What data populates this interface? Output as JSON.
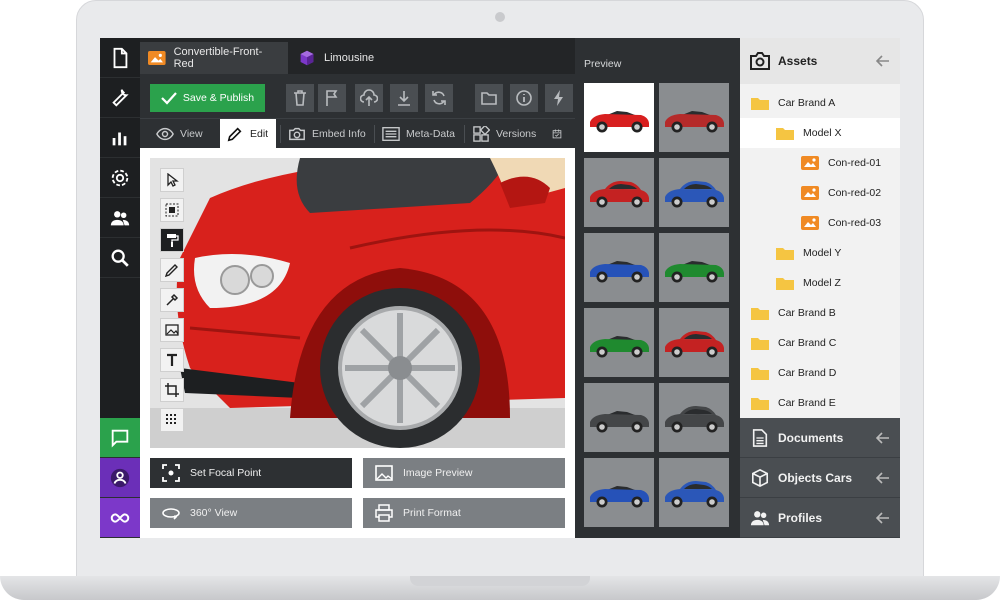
{
  "tabs": [
    {
      "label": "Convertible-Front-Red",
      "icon": "image-icon"
    },
    {
      "label": "Limousine",
      "icon": "cube-icon"
    }
  ],
  "toolbar": {
    "save_label": "Save & Publish",
    "buttons": [
      "trash-icon",
      "flag-icon",
      "upload-icon",
      "download-icon",
      "refresh-icon",
      "folder-icon",
      "info-icon",
      "lightning-icon"
    ]
  },
  "modes": [
    {
      "label": "View",
      "icon": "eye-icon"
    },
    {
      "label": "Edit",
      "icon": "pencil-icon"
    },
    {
      "label": "Embed Info",
      "icon": "camera-icon"
    },
    {
      "label": "Meta-Data",
      "icon": "list-icon"
    },
    {
      "label": "Versions",
      "icon": "versions-icon"
    }
  ],
  "edit_tools": [
    "cursor-icon",
    "select-icon",
    "paint-roller-icon",
    "pencil-icon",
    "eyedropper-icon",
    "image-icon",
    "text-icon",
    "crop-icon",
    "grid-icon"
  ],
  "actions": {
    "focal_point": "Set Focal Point",
    "image_preview": "Image Preview",
    "view_360": "360° View",
    "print_format": "Print Format"
  },
  "preview": {
    "title": "Preview",
    "thumbnails": [
      {
        "color": "#d81f1f",
        "kind": "convertible"
      },
      {
        "color": "#b52a2a",
        "kind": "convertible"
      },
      {
        "color": "#c42222",
        "kind": "sedan"
      },
      {
        "color": "#2b57b8",
        "kind": "sedan"
      },
      {
        "color": "#2652b8",
        "kind": "convertible"
      },
      {
        "color": "#1f8a2f",
        "kind": "convertible"
      },
      {
        "color": "#1f8a2f",
        "kind": "convertible"
      },
      {
        "color": "#c42222",
        "kind": "sedan"
      },
      {
        "color": "#444648",
        "kind": "convertible"
      },
      {
        "color": "#444648",
        "kind": "sedan"
      },
      {
        "color": "#2652b8",
        "kind": "convertible"
      },
      {
        "color": "#2b57b8",
        "kind": "sedan"
      }
    ]
  },
  "assets": {
    "title": "Assets",
    "tree": [
      {
        "label": "Car Brand A",
        "type": "folder",
        "level": 0
      },
      {
        "label": "Model X",
        "type": "folder",
        "level": 1,
        "selected": true
      },
      {
        "label": "Con-red-01",
        "type": "image",
        "level": 2
      },
      {
        "label": "Con-red-02",
        "type": "image",
        "level": 2
      },
      {
        "label": "Con-red-03",
        "type": "image",
        "level": 2
      },
      {
        "label": "Model Y",
        "type": "folder",
        "level": 1
      },
      {
        "label": "Model Z",
        "type": "folder",
        "level": 1
      },
      {
        "label": "Car Brand B",
        "type": "folder",
        "level": 0
      },
      {
        "label": "Car Brand C",
        "type": "folder",
        "level": 0
      },
      {
        "label": "Car Brand D",
        "type": "folder",
        "level": 0
      },
      {
        "label": "Car Brand E",
        "type": "folder",
        "level": 0
      }
    ],
    "sections": [
      "Documents",
      "Objects Cars",
      "Profiles"
    ]
  },
  "colors": {
    "accent_green": "#2ba24c",
    "accent_purple": "#6b2fb8",
    "folder": "#f5c542",
    "image_file": "#f08a24",
    "car_red": "#d8211c"
  }
}
